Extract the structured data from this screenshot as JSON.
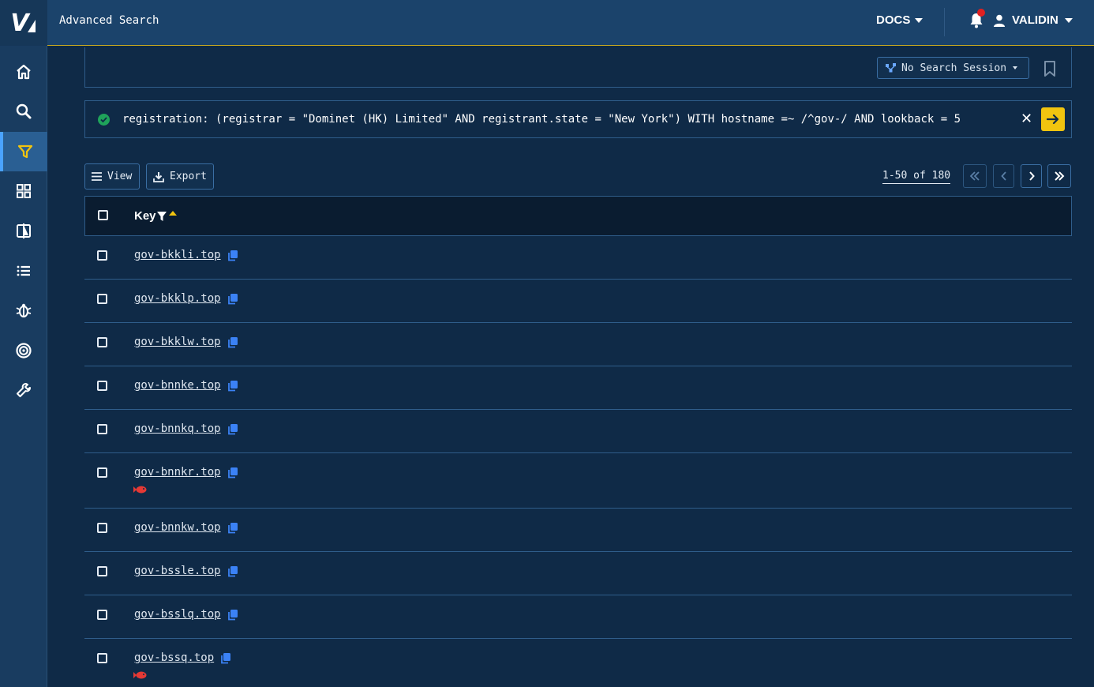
{
  "app": {
    "logo_text": "V",
    "page_title": "Advanced Search"
  },
  "header": {
    "docs_label": "DOCS",
    "user_label": "VALIDIN"
  },
  "sidebar": {
    "items": [
      {
        "name": "home-icon"
      },
      {
        "name": "search-icon"
      },
      {
        "name": "filter-icon",
        "active": true
      },
      {
        "name": "grid-icon"
      },
      {
        "name": "compare-icon"
      },
      {
        "name": "list-icon"
      },
      {
        "name": "bug-icon"
      },
      {
        "name": "target-icon"
      },
      {
        "name": "wrench-icon"
      }
    ]
  },
  "session": {
    "label": "No Search Session"
  },
  "query": {
    "text": "registration: (registrar = \"Dominet (HK) Limited\" AND registrant.state = \"New York\") WITH hostname =~ /^gov-/ AND lookback = 5"
  },
  "toolbar": {
    "view_label": "View",
    "export_label": "Export"
  },
  "pagination": {
    "range": "1-50 of 180"
  },
  "table": {
    "key_header": "Key",
    "rows": [
      {
        "key": "gov-bkkli.top",
        "phish": false
      },
      {
        "key": "gov-bkklp.top",
        "phish": false
      },
      {
        "key": "gov-bkklw.top",
        "phish": false
      },
      {
        "key": "gov-bnnke.top",
        "phish": false
      },
      {
        "key": "gov-bnnkq.top",
        "phish": false
      },
      {
        "key": "gov-bnnkr.top",
        "phish": true
      },
      {
        "key": "gov-bnnkw.top",
        "phish": false
      },
      {
        "key": "gov-bssle.top",
        "phish": false
      },
      {
        "key": "gov-bsslq.top",
        "phish": false
      },
      {
        "key": "gov-bssq.top",
        "phish": true
      }
    ]
  },
  "colors": {
    "accent": "#f1c40f",
    "background": "#0f2a47",
    "header": "#1b436b",
    "copy": "#3b82f6",
    "phish": "#e53935"
  }
}
